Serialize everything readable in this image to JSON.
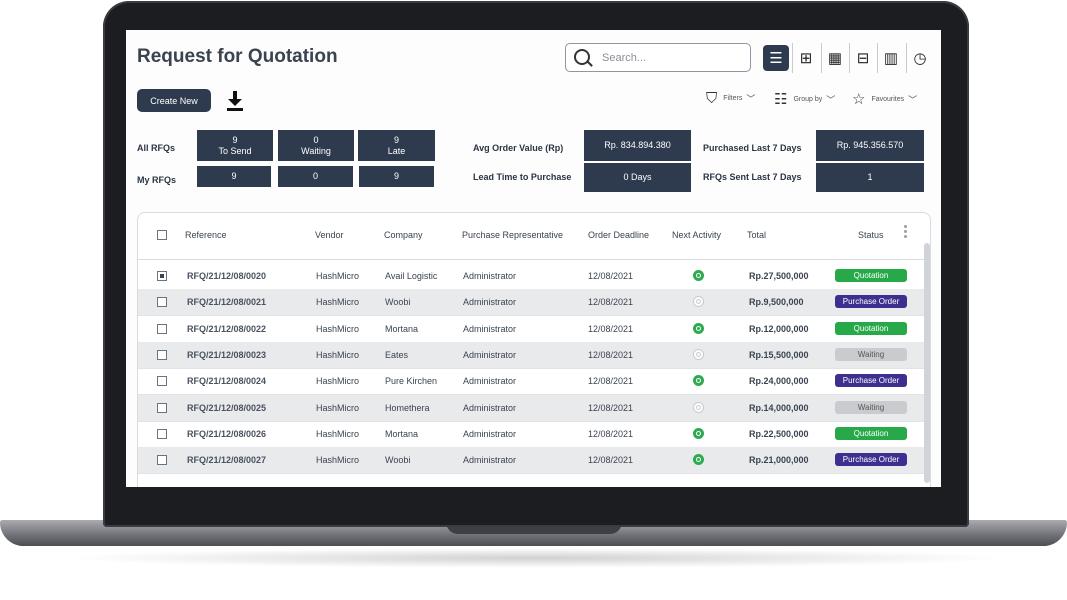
{
  "page": {
    "title": "Request for Quotation"
  },
  "search": {
    "placeholder": "Search..."
  },
  "views": [
    "list-icon",
    "kanban-icon",
    "calendar-icon",
    "pivot-icon",
    "graph-icon",
    "activity-icon"
  ],
  "toolbar": {
    "create_label": "Create New",
    "filters_label": "Filters",
    "groupby_label": "Group by",
    "favourites_label": "Favourites"
  },
  "summary": {
    "all_rfqs_label": "All RFQs",
    "my_rfqs_label": "My RFQs",
    "all": [
      {
        "count": "9",
        "label": "To Send"
      },
      {
        "count": "0",
        "label": "Waiting"
      },
      {
        "count": "9",
        "label": "Late"
      }
    ],
    "my": [
      "9",
      "0",
      "9"
    ],
    "avg_order_label": "Avg Order Value (Rp)",
    "avg_order_value": "Rp. 834.894.380",
    "lead_time_label": "Lead Time to Purchase",
    "lead_time_value": "0 Days",
    "purchased_label": "Purchased Last 7 Days",
    "purchased_value": "Rp. 945.356.570",
    "rfqs_sent_label": "RFQs Sent Last 7 Days",
    "rfqs_sent_value": "1"
  },
  "table": {
    "columns": [
      "Reference",
      "Vendor",
      "Company",
      "Purchase Representative",
      "Order Deadline",
      "Next Activity",
      "Total",
      "Status"
    ],
    "rows": [
      {
        "reference": "RFQ/21/12/08/0020",
        "vendor": "HashMicro",
        "company": "Avail Logistic",
        "rep": "Administrator",
        "deadline": "12/08/2021",
        "activity": "green",
        "total": "Rp.27,500,000",
        "status": "Quotation",
        "status_type": "quotation",
        "checked": true
      },
      {
        "reference": "RFQ/21/12/08/0021",
        "vendor": "HashMicro",
        "company": "Woobi",
        "rep": "Administrator",
        "deadline": "12/08/2021",
        "activity": "gray",
        "total": "Rp.9,500,000",
        "status": "Purchase Order",
        "status_type": "po",
        "checked": false
      },
      {
        "reference": "RFQ/21/12/08/0022",
        "vendor": "HashMicro",
        "company": "Mortana",
        "rep": "Administrator",
        "deadline": "12/08/2021",
        "activity": "green",
        "total": "Rp.12,000,000",
        "status": "Quotation",
        "status_type": "quotation",
        "checked": false
      },
      {
        "reference": "RFQ/21/12/08/0023",
        "vendor": "HashMicro",
        "company": "Eates",
        "rep": "Administrator",
        "deadline": "12/08/2021",
        "activity": "gray",
        "total": "Rp.15,500,000",
        "status": "Waiting",
        "status_type": "waiting",
        "checked": false
      },
      {
        "reference": "RFQ/21/12/08/0024",
        "vendor": "HashMicro",
        "company": "Pure Kirchen",
        "rep": "Administrator",
        "deadline": "12/08/2021",
        "activity": "green",
        "total": "Rp.24,000,000",
        "status": "Purchase Order",
        "status_type": "po",
        "checked": false
      },
      {
        "reference": "RFQ/21/12/08/0025",
        "vendor": "HashMicro",
        "company": "Homethera",
        "rep": "Administrator",
        "deadline": "12/08/2021",
        "activity": "gray",
        "total": "Rp.14,000,000",
        "status": "Waiting",
        "status_type": "waiting",
        "checked": false
      },
      {
        "reference": "RFQ/21/12/08/0026",
        "vendor": "HashMicro",
        "company": "Mortana",
        "rep": "Administrator",
        "deadline": "12/08/2021",
        "activity": "green",
        "total": "Rp.22,500,000",
        "status": "Quotation",
        "status_type": "quotation",
        "checked": false
      },
      {
        "reference": "RFQ/21/12/08/0027",
        "vendor": "HashMicro",
        "company": "Woobi",
        "rep": "Administrator",
        "deadline": "12/08/2021",
        "activity": "green",
        "total": "Rp.21,000,000",
        "status": "Purchase Order",
        "status_type": "po",
        "checked": false
      }
    ]
  },
  "colors": {
    "primary": "#2e3a4d",
    "quotation": "#27a94a",
    "purchase_order": "#3c2f8f",
    "waiting": "#c9cbcf"
  }
}
